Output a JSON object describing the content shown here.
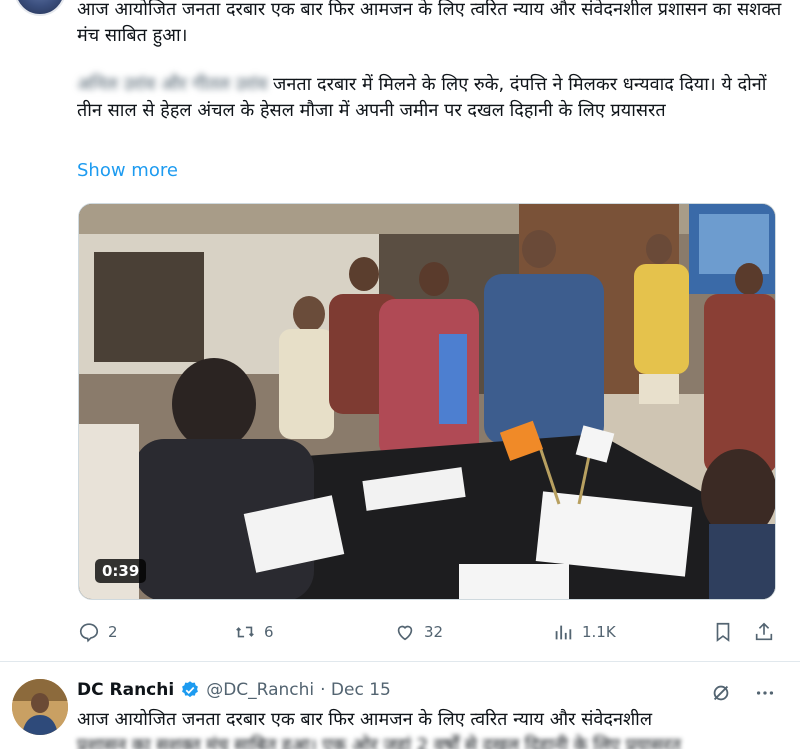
{
  "tweet1": {
    "paragraph1": "आज आयोजित जनता दरबार एक बार फिर आमजन के लिए त्वरित न्याय और संवेदनशील प्रशासन का सशक्त मंच साबित हुआ।",
    "paragraph2_blurred": "अनिल उरांव और गीतल उरांव",
    "paragraph2": " जनता दरबार में मिलने के लिए रुके, दंपत्ति ने मिलकर धन्यवाद दिया। ये दोनों तीन साल से हेहल अंचल के हेसल मौजा में अपनी जमीन पर दखल दिहानी के लिए प्रयासरत",
    "show_more": "Show more",
    "video_duration": "0:39",
    "actions": {
      "replies": "2",
      "reposts": "6",
      "likes": "32",
      "views": "1.1K"
    }
  },
  "tweet2": {
    "name": "DC Ranchi",
    "handle": "@DC_Ranchi",
    "date": "· Dec 15",
    "paragraph1": "आज आयोजित जनता दरबार एक बार फिर आमजन के लिए त्वरित न्याय और संवेदनशील",
    "paragraph2": "प्रशासन का सशक्त मंच साबित हुआ। एक ओर जहां 2 वर्षों से दखल दिहानी के लिए प्रयासरत"
  },
  "colors": {
    "accent": "#1d9bf0",
    "muted": "#536471",
    "text": "#0f1419",
    "divider": "#e1e8ed"
  },
  "icons": [
    "reply-icon",
    "repost-icon",
    "like-icon",
    "views-icon",
    "bookmark-icon",
    "share-icon",
    "verified-badge-icon",
    "grok-icon",
    "more-icon"
  ]
}
